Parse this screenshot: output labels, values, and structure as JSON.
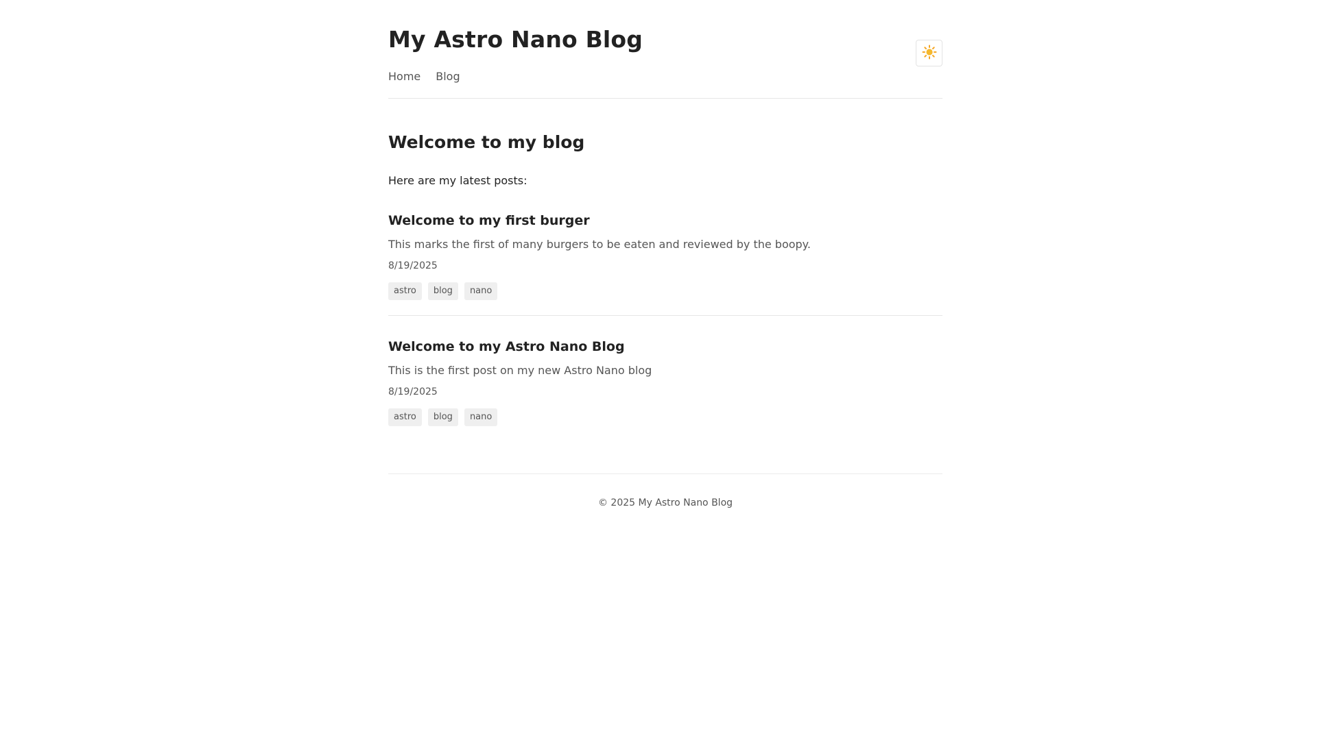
{
  "site": {
    "title": "My Astro Nano Blog"
  },
  "nav": {
    "items": [
      {
        "label": "Home"
      },
      {
        "label": "Blog"
      }
    ]
  },
  "theme_toggle": {
    "icon": "sun-icon",
    "glyph": "☀️",
    "color": "#f5a623"
  },
  "main": {
    "title": "Welcome to my blog",
    "intro": "Here are my latest posts:",
    "posts": [
      {
        "title": "Welcome to my first burger",
        "description": "This marks the first of many burgers to be eaten and reviewed by the boopy.",
        "date": "8/19/2025",
        "tags": [
          "astro",
          "blog",
          "nano"
        ]
      },
      {
        "title": "Welcome to my Astro Nano Blog",
        "description": "This is the first post on my new Astro Nano blog",
        "date": "8/19/2025",
        "tags": [
          "astro",
          "blog",
          "nano"
        ]
      }
    ]
  },
  "footer": {
    "copyright": "© 2025 My Astro Nano Blog"
  }
}
